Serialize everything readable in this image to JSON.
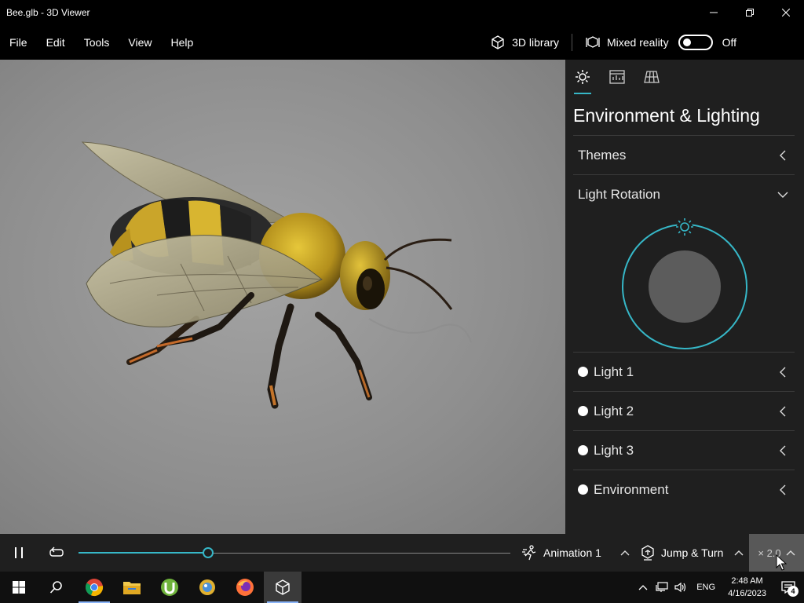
{
  "window": {
    "title": "Bee.glb - 3D Viewer"
  },
  "menu": {
    "items": [
      "File",
      "Edit",
      "Tools",
      "View",
      "Help"
    ],
    "library_label": "3D library",
    "mixed_reality_label": "Mixed reality",
    "mixed_reality_state": "Off"
  },
  "panel": {
    "heading": "Environment & Lighting",
    "sections": {
      "themes": "Themes",
      "light_rotation": "Light Rotation",
      "light1": "Light 1",
      "light2": "Light 2",
      "light3": "Light 3",
      "environment": "Environment"
    }
  },
  "playback": {
    "progress": 0.3,
    "animation_label": "Animation 1",
    "motion_label": "Jump & Turn",
    "speed_label": "× 2.0"
  },
  "taskbar": {
    "language": "ENG",
    "time": "2:48 AM",
    "date": "4/16/2023",
    "notification_count": "4"
  },
  "colors": {
    "accent": "#36b7c7",
    "panel_bg": "#1f1f1f",
    "viewport_bg": "#8e8e8e"
  }
}
